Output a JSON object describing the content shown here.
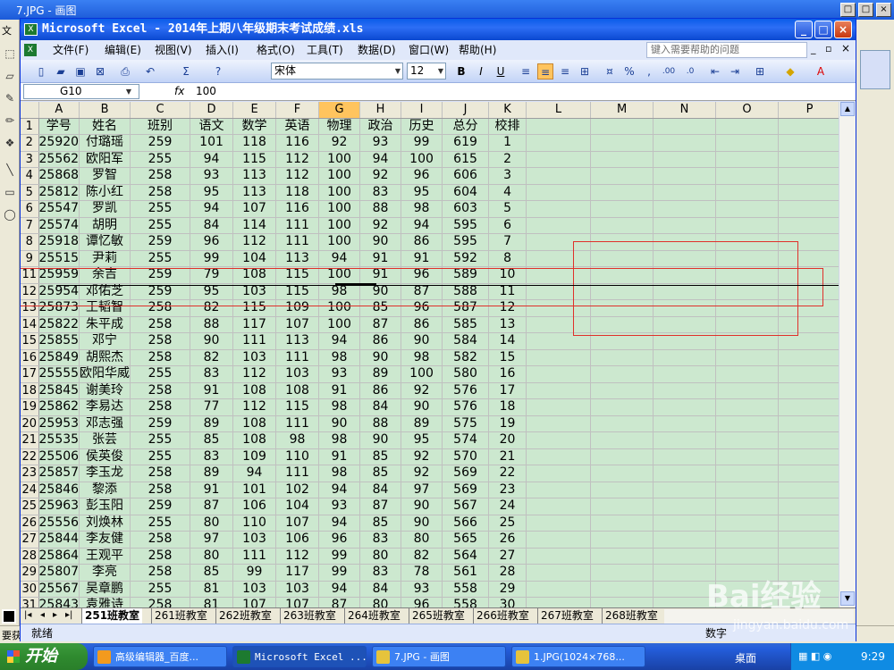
{
  "paint": {
    "title": "7.JPG - 画图",
    "menu_fragment": "文",
    "status_fragment": "要获",
    "restore_label": "□",
    "close_label": "×",
    "min_label": "_"
  },
  "excel": {
    "title": "Microsoft Excel - 2014年上期八年级期末考试成绩.xls",
    "min_label": "_",
    "max_label": "□",
    "close_label": "×",
    "menu": [
      "文件(F)",
      "编辑(E)",
      "视图(V)",
      "插入(I)",
      "格式(O)",
      "工具(T)",
      "数据(D)",
      "窗口(W)",
      "帮助(H)"
    ],
    "help_placeholder": "键入需要帮助的问题",
    "font": "宋体",
    "font_size": "12",
    "bold": "B",
    "italic": "I",
    "underline": "U",
    "name_box": "G10",
    "fx": "fx",
    "formula_value": "100",
    "status": "就绪",
    "status_right": "数字",
    "columns": [
      "A",
      "B",
      "C",
      "D",
      "E",
      "F",
      "G",
      "H",
      "I",
      "J",
      "K",
      "L",
      "M",
      "N",
      "O",
      "P"
    ],
    "selected_column": "G",
    "headers": [
      "学号",
      "姓名",
      "班别",
      "语文",
      "数学",
      "英语",
      "物理",
      "政治",
      "历史",
      "总分",
      "校排"
    ],
    "rows": [
      {
        "row": "2",
        "cells": [
          "25920",
          "付璐瑶",
          "259",
          "101",
          "118",
          "116",
          "92",
          "93",
          "99",
          "619",
          "1"
        ]
      },
      {
        "row": "3",
        "cells": [
          "25562",
          "欧阳军",
          "255",
          "94",
          "115",
          "112",
          "100",
          "94",
          "100",
          "615",
          "2"
        ]
      },
      {
        "row": "4",
        "cells": [
          "25868",
          "罗智",
          "258",
          "93",
          "113",
          "112",
          "100",
          "92",
          "96",
          "606",
          "3"
        ]
      },
      {
        "row": "5",
        "cells": [
          "25812",
          "陈小红",
          "258",
          "95",
          "113",
          "118",
          "100",
          "83",
          "95",
          "604",
          "4"
        ]
      },
      {
        "row": "6",
        "cells": [
          "25547",
          "罗凯",
          "255",
          "94",
          "107",
          "116",
          "100",
          "88",
          "98",
          "603",
          "5"
        ]
      },
      {
        "row": "7",
        "cells": [
          "25574",
          "胡明",
          "255",
          "84",
          "114",
          "111",
          "100",
          "92",
          "94",
          "595",
          "6"
        ]
      },
      {
        "row": "8",
        "cells": [
          "25918",
          "谭忆敏",
          "259",
          "96",
          "112",
          "111",
          "100",
          "90",
          "86",
          "595",
          "7"
        ]
      },
      {
        "row": "9",
        "cells": [
          "25515",
          "尹莉",
          "255",
          "99",
          "104",
          "113",
          "94",
          "91",
          "91",
          "592",
          "8"
        ]
      },
      {
        "row": "11",
        "cells": [
          "25959",
          "余吉",
          "259",
          "79",
          "108",
          "115",
          "100",
          "91",
          "96",
          "589",
          "10"
        ]
      },
      {
        "row": "12",
        "cells": [
          "25954",
          "邓佑芝",
          "259",
          "95",
          "103",
          "115",
          "98",
          "90",
          "87",
          "588",
          "11"
        ]
      },
      {
        "row": "13",
        "cells": [
          "25873",
          "王韬智",
          "258",
          "82",
          "115",
          "109",
          "100",
          "85",
          "96",
          "587",
          "12"
        ]
      },
      {
        "row": "14",
        "cells": [
          "25822",
          "朱平成",
          "258",
          "88",
          "117",
          "107",
          "100",
          "87",
          "86",
          "585",
          "13"
        ]
      },
      {
        "row": "15",
        "cells": [
          "25855",
          "邓宁",
          "258",
          "90",
          "111",
          "113",
          "94",
          "86",
          "90",
          "584",
          "14"
        ]
      },
      {
        "row": "16",
        "cells": [
          "25849",
          "胡熙杰",
          "258",
          "82",
          "103",
          "111",
          "98",
          "90",
          "98",
          "582",
          "15"
        ]
      },
      {
        "row": "17",
        "cells": [
          "25555",
          "欧阳华威",
          "255",
          "83",
          "112",
          "103",
          "93",
          "89",
          "100",
          "580",
          "16"
        ]
      },
      {
        "row": "18",
        "cells": [
          "25845",
          "谢美玲",
          "258",
          "91",
          "108",
          "108",
          "91",
          "86",
          "92",
          "576",
          "17"
        ]
      },
      {
        "row": "19",
        "cells": [
          "25862",
          "李易达",
          "258",
          "77",
          "112",
          "115",
          "98",
          "84",
          "90",
          "576",
          "18"
        ]
      },
      {
        "row": "20",
        "cells": [
          "25953",
          "邓志强",
          "259",
          "89",
          "108",
          "111",
          "90",
          "88",
          "89",
          "575",
          "19"
        ]
      },
      {
        "row": "21",
        "cells": [
          "25535",
          "张芸",
          "255",
          "85",
          "108",
          "98",
          "98",
          "90",
          "95",
          "574",
          "20"
        ]
      },
      {
        "row": "22",
        "cells": [
          "25506",
          "侯英俊",
          "255",
          "83",
          "109",
          "110",
          "91",
          "85",
          "92",
          "570",
          "21"
        ]
      },
      {
        "row": "23",
        "cells": [
          "25857",
          "李玉龙",
          "258",
          "89",
          "94",
          "111",
          "98",
          "85",
          "92",
          "569",
          "22"
        ]
      },
      {
        "row": "24",
        "cells": [
          "25846",
          "黎添",
          "258",
          "91",
          "101",
          "102",
          "94",
          "84",
          "97",
          "569",
          "23"
        ]
      },
      {
        "row": "25",
        "cells": [
          "25963",
          "彭玉阳",
          "259",
          "87",
          "106",
          "104",
          "93",
          "87",
          "90",
          "567",
          "24"
        ]
      },
      {
        "row": "26",
        "cells": [
          "25556",
          "刘焕林",
          "255",
          "80",
          "110",
          "107",
          "94",
          "85",
          "90",
          "566",
          "25"
        ]
      },
      {
        "row": "27",
        "cells": [
          "25844",
          "李友健",
          "258",
          "97",
          "103",
          "106",
          "96",
          "83",
          "80",
          "565",
          "26"
        ]
      },
      {
        "row": "28",
        "cells": [
          "25864",
          "王观平",
          "258",
          "80",
          "111",
          "112",
          "99",
          "80",
          "82",
          "564",
          "27"
        ]
      },
      {
        "row": "29",
        "cells": [
          "25807",
          "李亮",
          "258",
          "85",
          "99",
          "117",
          "99",
          "83",
          "78",
          "561",
          "28"
        ]
      },
      {
        "row": "30",
        "cells": [
          "25567",
          "吴章鹏",
          "255",
          "81",
          "103",
          "103",
          "94",
          "84",
          "93",
          "558",
          "29"
        ]
      },
      {
        "row": "31",
        "cells": [
          "25843",
          "袁雅诗",
          "258",
          "81",
          "107",
          "107",
          "87",
          "80",
          "96",
          "558",
          "30"
        ]
      }
    ],
    "sheets": [
      "251班教室",
      "261班教室",
      "262班教室",
      "263班教室",
      "264班教室",
      "265班教室",
      "266班教室",
      "267班教室",
      "268班教室"
    ],
    "active_sheet": "251班教室"
  },
  "taskbar": {
    "start": "开始",
    "tasks": [
      "高级编辑器_百度...",
      "Microsoft Excel ...",
      "7.JPG - 画图",
      "1.JPG(1024×768..."
    ],
    "desktop": "桌面",
    "clock": "9:29"
  },
  "watermark": {
    "text": "Bai经验",
    "url": "jingyan.baidu.com"
  },
  "colors": {
    "sheet_bg": "#cce8cf",
    "title_blue": "#0a5ce8",
    "red_box": "#e0302a",
    "taskbar": "#245edb",
    "start_green": "#3c9a3c"
  }
}
